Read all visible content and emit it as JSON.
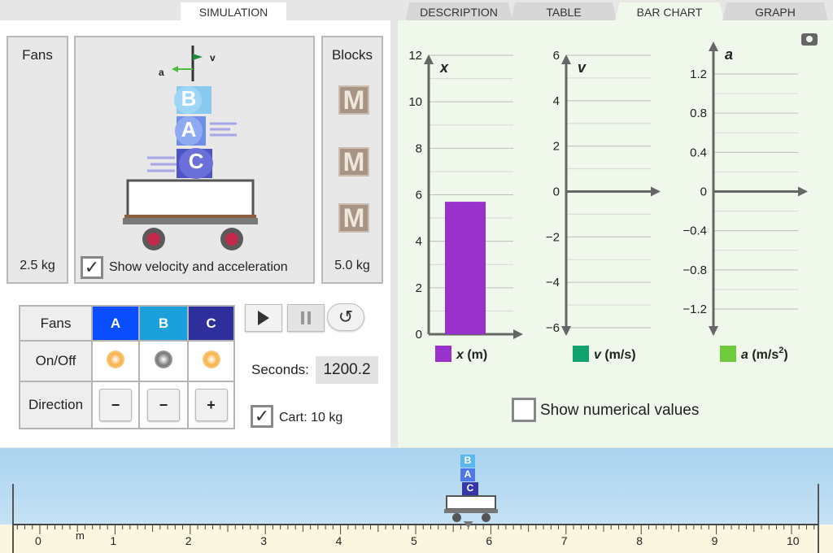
{
  "tabs": {
    "simulation": "SIMULATION",
    "description": "DESCRIPTION",
    "table": "TABLE",
    "bar_chart": "BAR CHART",
    "graph": "GRAPH"
  },
  "fans_panel": {
    "title": "Fans",
    "mass": "2.5 kg"
  },
  "blocks_panel": {
    "title": "Blocks",
    "mass": "5.0 kg",
    "blocks": [
      "M",
      "M",
      "M"
    ]
  },
  "cart_view": {
    "vector_a": "a",
    "vector_v": "v",
    "stack": [
      "B",
      "A",
      "C"
    ],
    "show_vectors_label": "Show velocity and acceleration",
    "show_vectors_checked": true
  },
  "fan_table": {
    "header": "Fans",
    "fans": [
      "A",
      "B",
      "C"
    ],
    "fan_colors": [
      "#0a4dff",
      "#1ba0dc",
      "#2e2f9c"
    ],
    "row_onoff": "On/Off",
    "row_direction": "Direction",
    "onoff_states": [
      "on",
      "off",
      "on"
    ],
    "directions": [
      "−",
      "−",
      "+"
    ]
  },
  "controls": {
    "seconds_label": "Seconds:",
    "seconds_value": "1200.2",
    "cart_label": "Cart: 10 kg",
    "cart_checked": true
  },
  "show_numerical_label": "Show numerical values",
  "chart_data": [
    {
      "type": "bar",
      "title": "x",
      "legend": "x (m)",
      "color": "#9932cc",
      "ylim": [
        0,
        12
      ],
      "ticks": [
        "0",
        "2",
        "4",
        "6",
        "8",
        "10",
        "12"
      ],
      "values": [
        5.7
      ]
    },
    {
      "type": "bar",
      "title": "v",
      "legend": "v (m/s)",
      "color": "#10a370",
      "ylim": [
        -6,
        6
      ],
      "ticks": [
        "−6",
        "−4",
        "−2",
        "0",
        "2",
        "4",
        "6"
      ],
      "values": [
        0
      ]
    },
    {
      "type": "bar",
      "title": "a",
      "legend": "a (m/s",
      "legend_sup": "2",
      "legend_end": ")",
      "color": "#6ecb3e",
      "ylim": [
        -1.6,
        1.6
      ],
      "ticks": [
        "−1.2",
        "−0.8",
        "−0.4",
        "0",
        "0.4",
        "0.8",
        "1.2"
      ],
      "values": [
        0
      ]
    }
  ],
  "ruler": {
    "unit": "m",
    "labels": [
      "0",
      "1",
      "2",
      "3",
      "4",
      "5",
      "6",
      "7",
      "8",
      "9",
      "10"
    ],
    "cart_position": 5.7,
    "mini_stack": [
      "B",
      "A",
      "C"
    ]
  }
}
